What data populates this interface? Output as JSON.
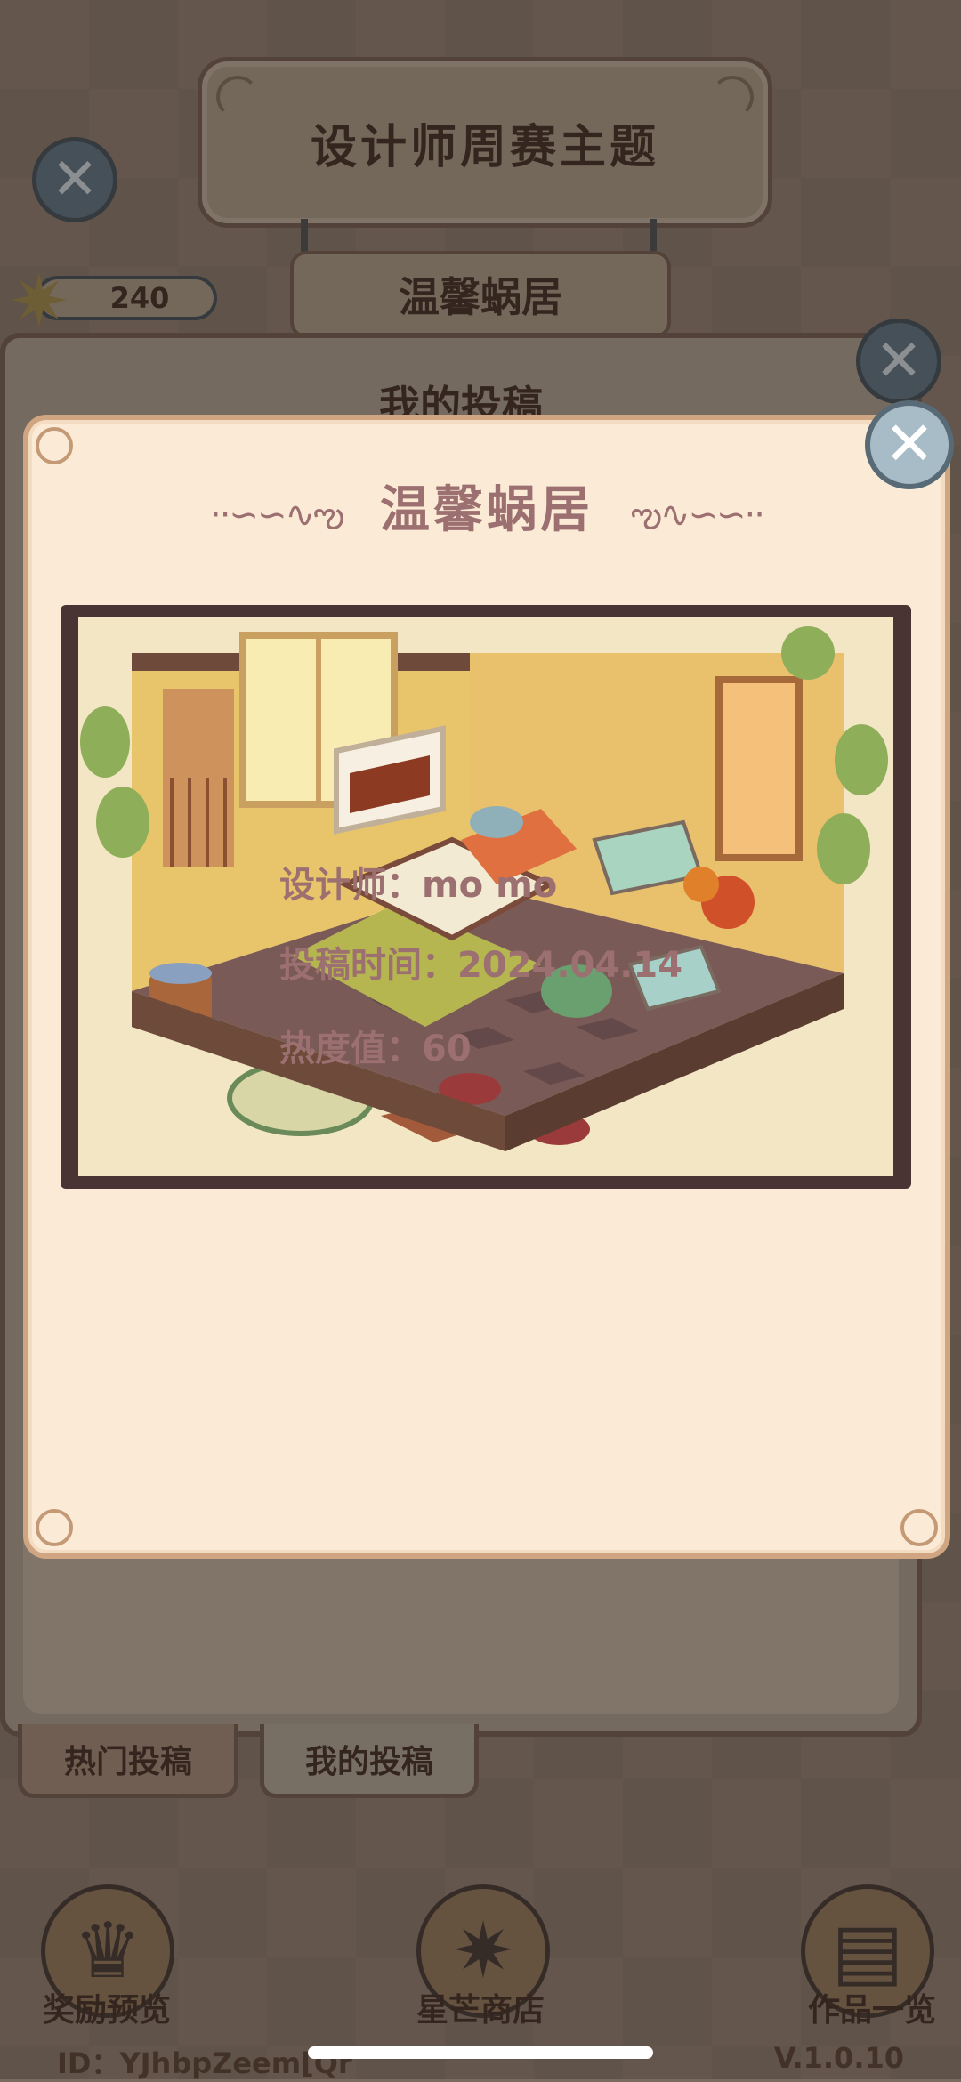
{
  "header": {
    "title": "设计师周赛主题",
    "theme": "温馨蜗居",
    "star_points": "240"
  },
  "underlay": {
    "title": "我的投稿",
    "tabs": [
      "热门投稿",
      "我的投稿"
    ]
  },
  "modal": {
    "title": "温馨蜗居",
    "designer_label": "设计师：",
    "designer_value": "mo mo",
    "time_label": "投稿时间：",
    "time_value": "2024.04.14",
    "heat_label": "热度值：",
    "heat_value": "60"
  },
  "nav": {
    "reward_preview": "奖励预览",
    "star_shop": "星芒商店",
    "works_list": "作品一览"
  },
  "footer": {
    "id_text": "ID：YJhbpZeem[Qr",
    "version": "V.1.0.10"
  },
  "colors": {
    "modal_bg": "#fbebd6",
    "modal_text": "#9c7070",
    "frame": "#4a3333",
    "close_button": "#a8bcc8"
  }
}
